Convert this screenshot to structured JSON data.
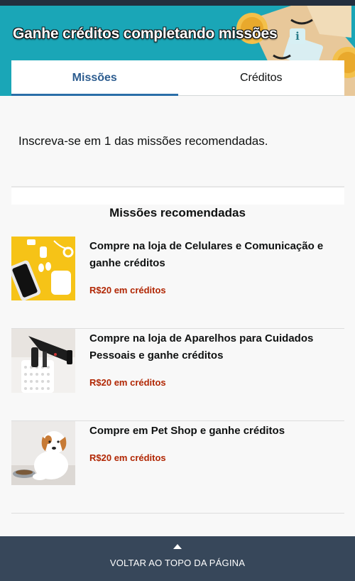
{
  "header": {
    "title": "Ganhe créditos completando missões",
    "info_icon": "i"
  },
  "tabs": [
    {
      "label": "Missões",
      "active": true
    },
    {
      "label": "Créditos",
      "active": false
    }
  ],
  "intro": "Inscreva-se em 1 das missões recomendadas.",
  "section_title": "Missões recomendadas",
  "missions": [
    {
      "title": "Compre na loja de Celulares e Comunicação e ganhe créditos",
      "reward": "R$20 em créditos",
      "image": "phone-products-image"
    },
    {
      "title": "Compre na loja de Aparelhos para Cuidados Pessoais e ganhe créditos",
      "reward": "R$20 em créditos",
      "image": "hair-dryer-image"
    },
    {
      "title": "Compre em Pet Shop e ganhe créditos",
      "reward": "R$20 em créditos",
      "image": "puppy-image"
    }
  ],
  "footer": {
    "label": "VOLTAR AO TOPO DA PÁGINA",
    "icon": "caret-up-icon"
  },
  "colors": {
    "hero_bg": "#1aa6b7",
    "tab_active": "#2c5c8f",
    "reward": "#b12704",
    "footer_bg": "#37475a"
  }
}
